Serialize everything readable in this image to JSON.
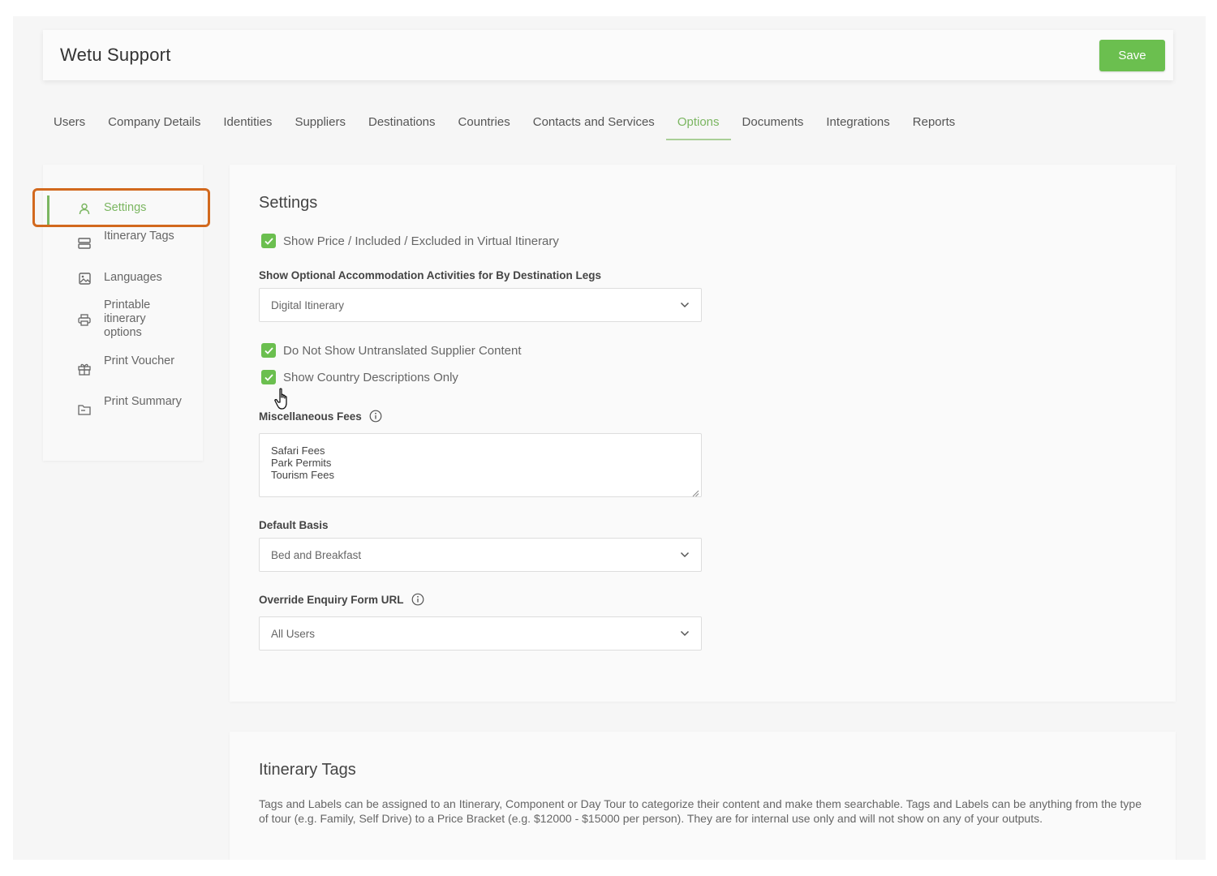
{
  "header": {
    "title": "Wetu Support",
    "save_label": "Save"
  },
  "tabs": [
    {
      "label": "Users"
    },
    {
      "label": "Company Details"
    },
    {
      "label": "Identities"
    },
    {
      "label": "Suppliers"
    },
    {
      "label": "Destinations"
    },
    {
      "label": "Countries"
    },
    {
      "label": "Contacts and Services"
    },
    {
      "label": "Options"
    },
    {
      "label": "Documents"
    },
    {
      "label": "Integrations"
    },
    {
      "label": "Reports"
    }
  ],
  "active_tab": "Options",
  "sidebar": {
    "items": [
      {
        "label": "Settings",
        "icon": "user-icon"
      },
      {
        "label": "Itinerary Tags",
        "icon": "tags-icon"
      },
      {
        "label": "Languages",
        "icon": "image-icon"
      },
      {
        "label": "Printable itinerary options",
        "icon": "printer-icon"
      },
      {
        "label": "Print Voucher",
        "icon": "gift-icon"
      },
      {
        "label": "Print Summary",
        "icon": "folder-icon"
      }
    ]
  },
  "settings": {
    "title": "Settings",
    "show_price_label": "Show Price / Included / Excluded in Virtual Itinerary",
    "show_optional_label": "Show Optional Accommodation Activities for By Destination Legs",
    "show_optional_value": "Digital Itinerary",
    "untranslated_label": "Do Not Show Untranslated Supplier Content",
    "country_desc_label": "Show Country Descriptions Only",
    "misc_fees_label": "Miscellaneous Fees",
    "misc_fees_lines": [
      "Safari Fees",
      "Park Permits",
      "Tourism Fees"
    ],
    "default_basis_label": "Default Basis",
    "default_basis_value": "Bed and Breakfast",
    "override_url_label": "Override Enquiry Form URL",
    "override_url_value": "All Users"
  },
  "itinerary_tags": {
    "title": "Itinerary Tags",
    "description": "Tags and Labels can be assigned to an Itinerary, Component or Day Tour to categorize their content and make them searchable. Tags and Labels can be anything from the type of tour (e.g. Family, Self Drive) to a Price Bracket (e.g. $12000 - $15000 per person). They are for internal use only and will not show on any of your outputs."
  },
  "colors": {
    "accent": "#7bb661",
    "save": "#6bbf4f",
    "highlight": "#d2691e"
  }
}
